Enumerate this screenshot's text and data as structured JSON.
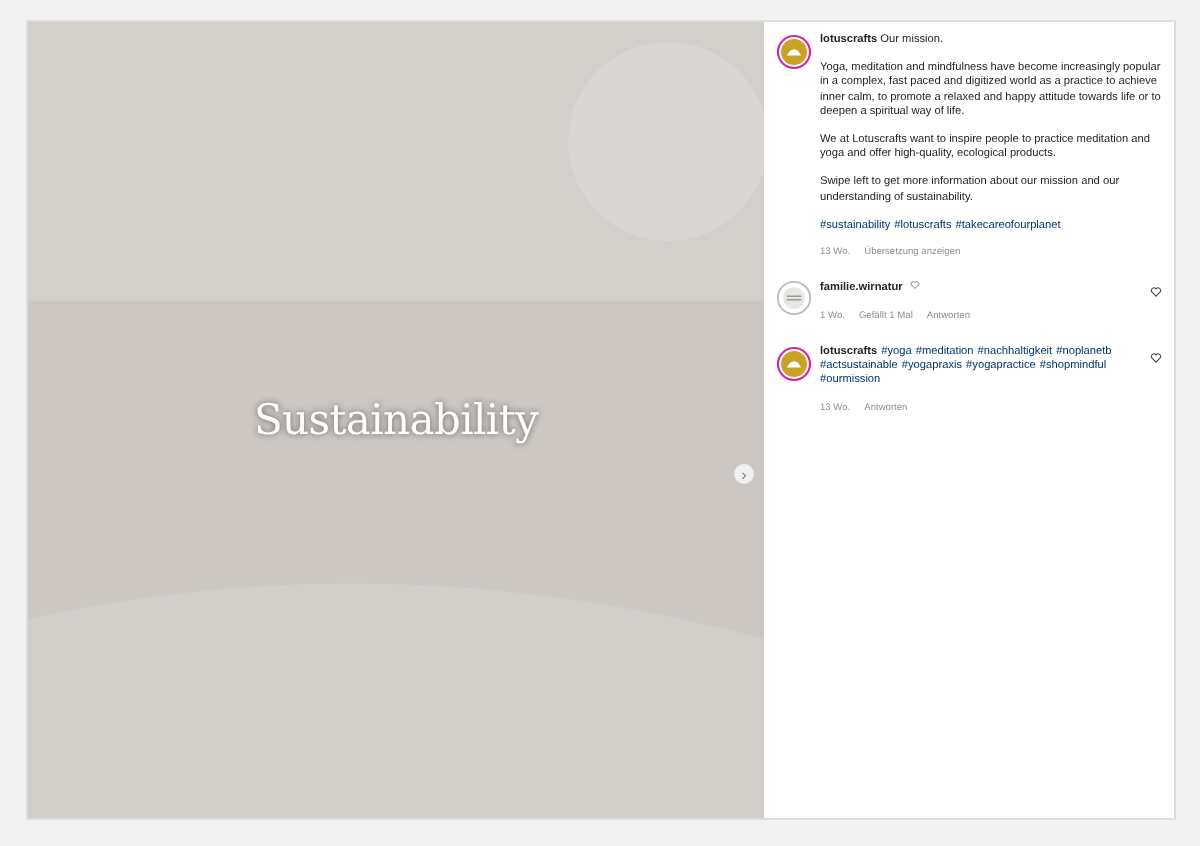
{
  "slide": {
    "title": "Sustainability",
    "next": "›"
  },
  "post": {
    "username": "lotuscrafts",
    "intro": "Our mission.",
    "paragraphs": [
      "Yoga, meditation and mindfulness have become increasingly popular in a complex, fast paced and digitized world as a practice to achieve inner calm, to promote a relaxed and happy attitude towards life or to deepen a spiritual way of life.",
      "We at Lotuscrafts want to inspire people to practice meditation and yoga and offer high-quality, ecological products.",
      "Swipe left to get more information about our mission and our understanding of sustainability."
    ],
    "hashtags": [
      "#sustainability",
      "#lotuscrafts",
      "#takecareofourplanet"
    ],
    "time": "13 Wo.",
    "translate": "Übersetzung anzeigen"
  },
  "comments": [
    {
      "username": "familie.wirnatur",
      "kind": "plain",
      "time": "1 Wo.",
      "likes": "Gefällt 1 Mal",
      "reply": "Antworten"
    },
    {
      "username": "lotuscrafts",
      "kind": "brand",
      "hashtags": [
        "#yoga",
        "#meditation",
        "#nachhaltigkeit",
        "#noplanetb",
        "#actsustainable",
        "#yogapraxis",
        "#yogapractice",
        "#shopmindful",
        "#ourmission"
      ],
      "time": "13 Wo.",
      "reply": "Antworten"
    }
  ]
}
